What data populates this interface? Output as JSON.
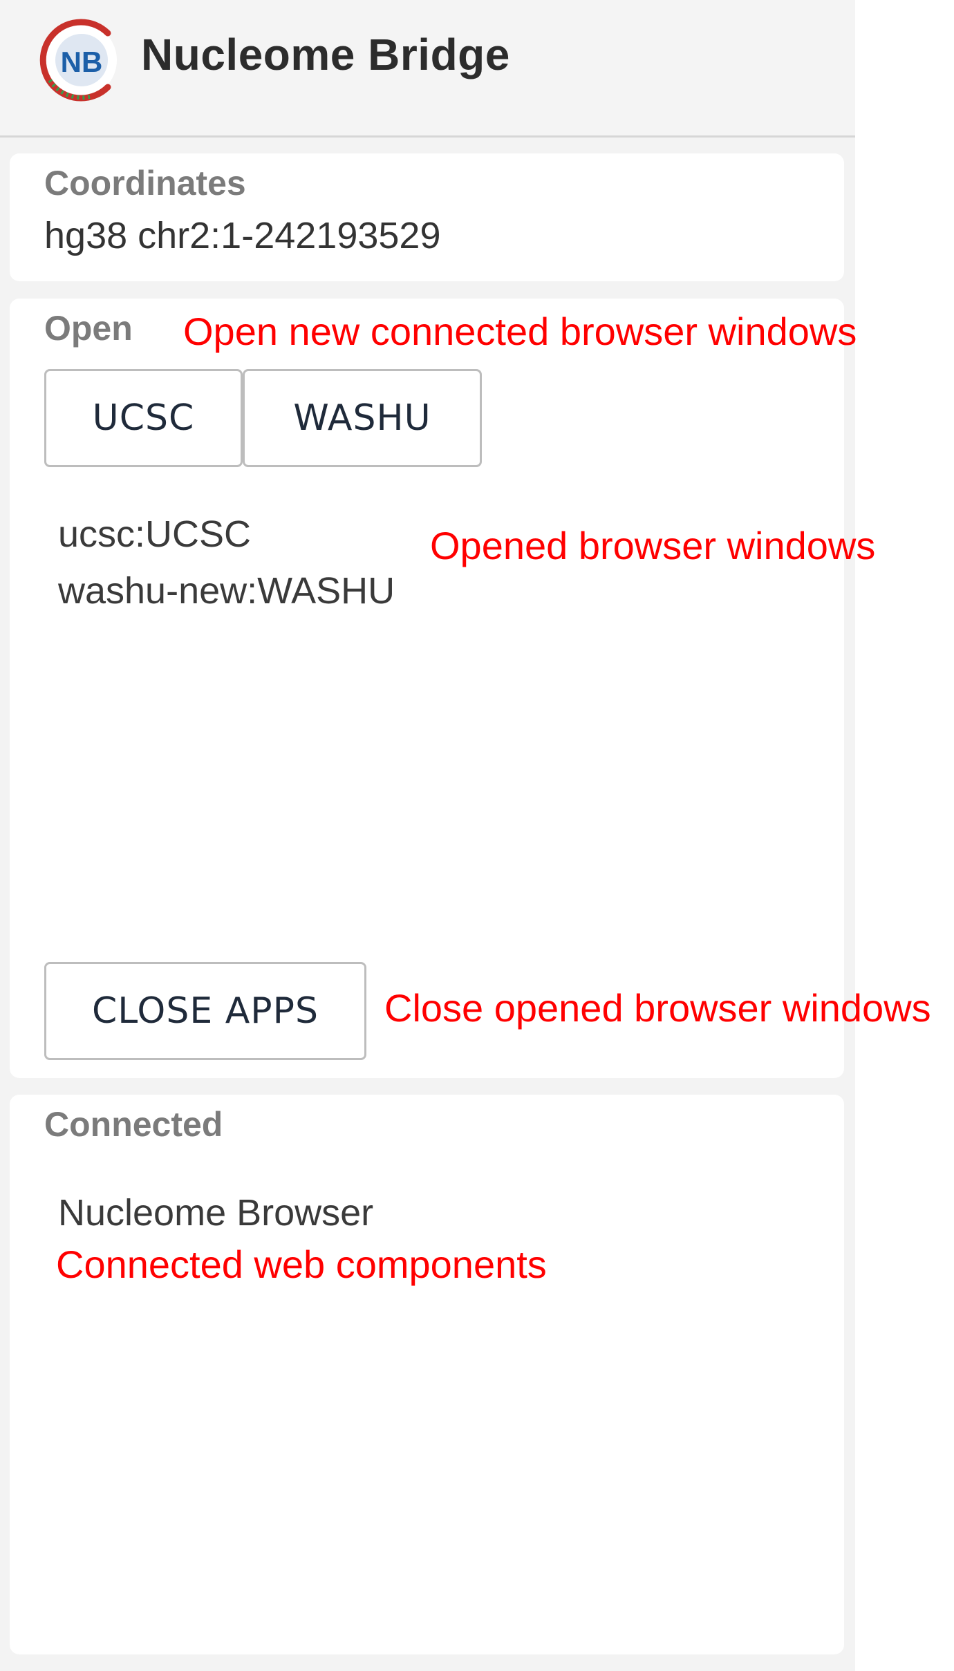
{
  "app": {
    "title": "Nucleome Bridge",
    "logo_text": "NB"
  },
  "coordinates": {
    "label": "Coordinates",
    "value": "hg38 chr2:1-242193529"
  },
  "open_section": {
    "label": "Open",
    "buttons": [
      {
        "label": "UCSC"
      },
      {
        "label": "WASHU"
      }
    ],
    "opened_windows": [
      "ucsc:UCSC",
      "washu-new:WASHU"
    ],
    "close_button_label": "CLOSE APPS"
  },
  "connected_section": {
    "label": "Connected",
    "items": [
      "Nucleome Browser"
    ]
  },
  "annotations": {
    "open_new": "Open new connected browser windows",
    "opened": "Opened browser windows",
    "close": "Close opened browser windows",
    "connected": "Connected web components"
  },
  "colors": {
    "annotation": "#ff0000",
    "logo_ring_red": "#c8312b",
    "logo_ring_green": "#3a9a4a",
    "logo_text": "#1c5fa8"
  }
}
